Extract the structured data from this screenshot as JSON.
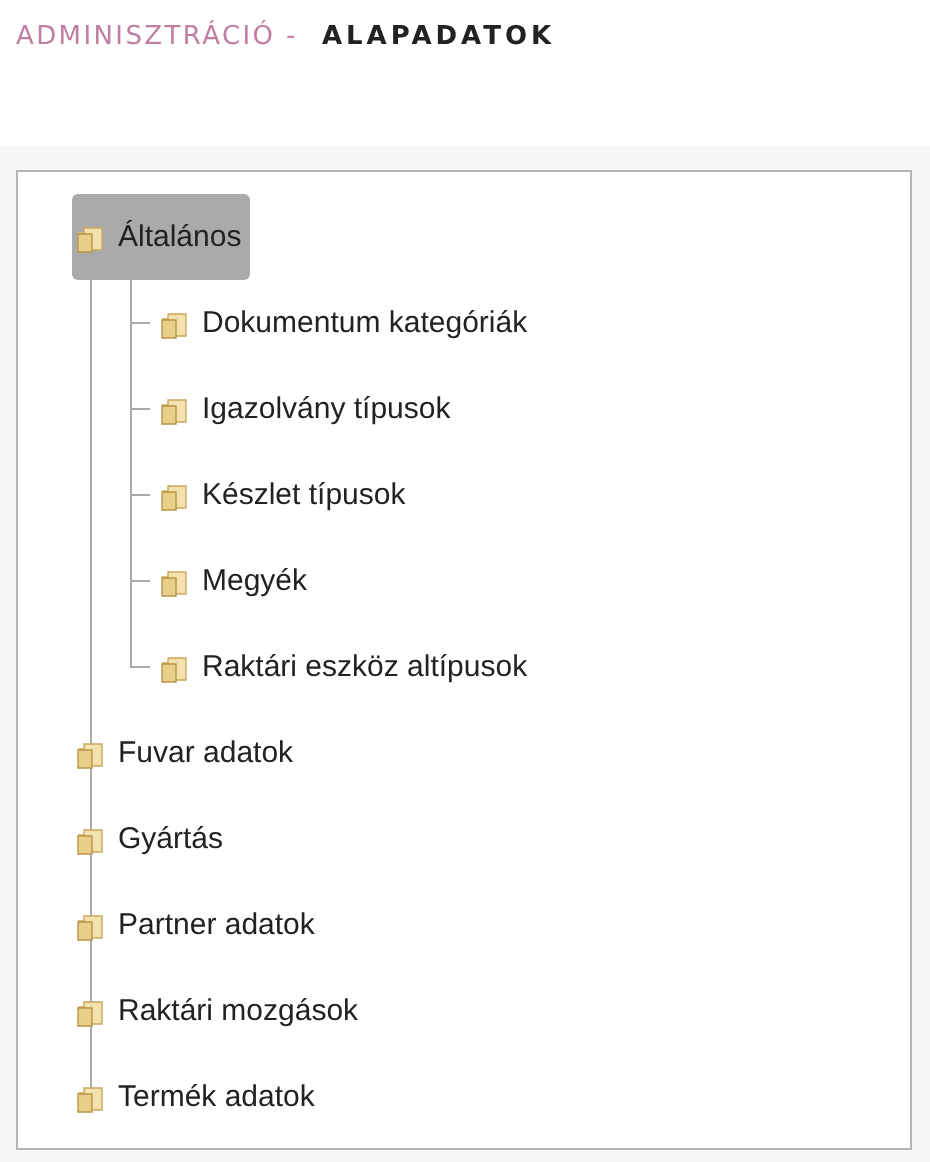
{
  "header": {
    "section": "ADMINISZTRÁCIÓ -",
    "page": "ALAPADATOK"
  },
  "tree": [
    {
      "label": "Általános",
      "selected": true,
      "children": [
        {
          "label": "Dokumentum kategóriák",
          "selected": false
        },
        {
          "label": "Igazolvány típusok",
          "selected": false
        },
        {
          "label": "Készlet típusok",
          "selected": false
        },
        {
          "label": "Megyék",
          "selected": false
        },
        {
          "label": "Raktári eszköz altípusok",
          "selected": false
        }
      ]
    },
    {
      "label": "Fuvar adatok",
      "selected": false
    },
    {
      "label": "Gyártás",
      "selected": false
    },
    {
      "label": "Partner adatok",
      "selected": false
    },
    {
      "label": "Raktári mozgások",
      "selected": false
    },
    {
      "label": "Termék adatok",
      "selected": false
    }
  ]
}
